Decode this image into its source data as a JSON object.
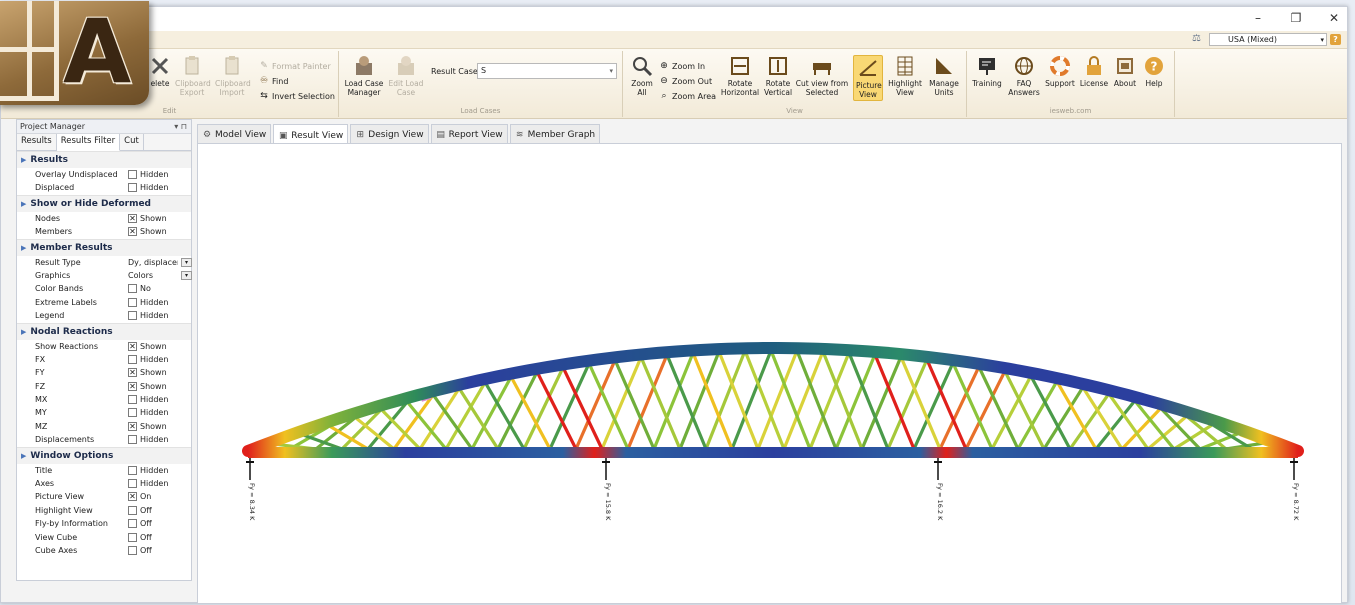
{
  "window": {
    "minimize": "–",
    "maximize": "❐",
    "close": "✕"
  },
  "units": {
    "selected": "USA (Mixed)"
  },
  "ribbon": {
    "edit": {
      "group_label": "Edit",
      "delete": "elete",
      "clipboard_export": "Clipboard Export",
      "clipboard_import": "Clipboard Import",
      "format_painter": "Format Painter",
      "find": "Find",
      "invert_selection": "Invert Selection"
    },
    "load_cases": {
      "group_label": "Load Cases",
      "load_case_manager": "Load Case Manager",
      "edit_load_case": "Edit Load Case",
      "result_case_label": "Result Case",
      "result_case_value": "S"
    },
    "view": {
      "group_label": "View",
      "zoom_all": "Zoom All",
      "zoom_in": "Zoom In",
      "zoom_out": "Zoom Out",
      "zoom_area": "Zoom Area",
      "rotate_horizontal": "Rotate Horizontal",
      "rotate_vertical": "Rotate Vertical",
      "cut_view": "Cut view from Selected",
      "picture_view": "Picture View",
      "highlight_view": "Highlight View",
      "manage_units": "Manage Units"
    },
    "iesweb": {
      "group_label": "iesweb.com",
      "training": "Training",
      "faq": "FAQ Answers",
      "support": "Support",
      "license": "License",
      "about": "About",
      "help": "Help"
    }
  },
  "panel": {
    "title": "Project Manager",
    "pin": "▾ ⊓",
    "tabs": [
      "Results",
      "Results Filter",
      "Cut"
    ],
    "sections": [
      {
        "title": "Results",
        "rows": [
          {
            "label": "Overlay Undisplaced",
            "checked": false,
            "value": "Hidden"
          },
          {
            "label": "Displaced",
            "checked": false,
            "value": "Hidden"
          }
        ]
      },
      {
        "title": "Show or Hide Deformed",
        "rows": [
          {
            "label": "Nodes",
            "checked": true,
            "value": "Shown"
          },
          {
            "label": "Members",
            "checked": true,
            "value": "Shown"
          }
        ]
      },
      {
        "title": "Member Results",
        "rows": [
          {
            "label": "Result Type",
            "dropdown": true,
            "value": "Dy, displacem"
          },
          {
            "label": "Graphics",
            "dropdown": true,
            "value": "Colors"
          },
          {
            "label": "Color Bands",
            "checked": false,
            "value": "No"
          },
          {
            "label": "Extreme Labels",
            "checked": false,
            "value": "Hidden"
          },
          {
            "label": "Legend",
            "checked": false,
            "value": "Hidden"
          }
        ]
      },
      {
        "title": "Nodal Reactions",
        "rows": [
          {
            "label": "Show Reactions",
            "checked": true,
            "value": "Shown"
          },
          {
            "label": "FX",
            "checked": false,
            "value": "Hidden"
          },
          {
            "label": "FY",
            "checked": true,
            "value": "Shown"
          },
          {
            "label": "FZ",
            "checked": true,
            "value": "Shown"
          },
          {
            "label": "MX",
            "checked": false,
            "value": "Hidden"
          },
          {
            "label": "MY",
            "checked": false,
            "value": "Hidden"
          },
          {
            "label": "MZ",
            "checked": true,
            "value": "Shown"
          },
          {
            "label": "Displacements",
            "checked": false,
            "value": "Hidden"
          }
        ]
      },
      {
        "title": "Window Options",
        "rows": [
          {
            "label": "Title",
            "checked": false,
            "value": "Hidden"
          },
          {
            "label": "Axes",
            "checked": false,
            "value": "Hidden"
          },
          {
            "label": "Picture View",
            "checked": true,
            "value": "On"
          },
          {
            "label": "Highlight View",
            "checked": false,
            "value": "Off"
          },
          {
            "label": "Fly-by Information",
            "checked": false,
            "value": "Off"
          },
          {
            "label": "View Cube",
            "checked": false,
            "value": "Off"
          },
          {
            "label": "Cube Axes",
            "checked": false,
            "value": "Off"
          }
        ]
      }
    ]
  },
  "doc_tabs": [
    {
      "label": "Model View",
      "active": false
    },
    {
      "label": "Result View",
      "active": true
    },
    {
      "label": "Design View",
      "active": false
    },
    {
      "label": "Report View",
      "active": false
    },
    {
      "label": "Member Graph",
      "active": false
    }
  ],
  "reactions": [
    "Fy = 8.34 K",
    "Fy = 15.8 K",
    "Fy = 16.2 K",
    "Fy = 8.72 K"
  ],
  "colors": {
    "accent": "#f9d874",
    "ribbon": "#f2ead8",
    "arch_blue": "#2b3f9e"
  }
}
